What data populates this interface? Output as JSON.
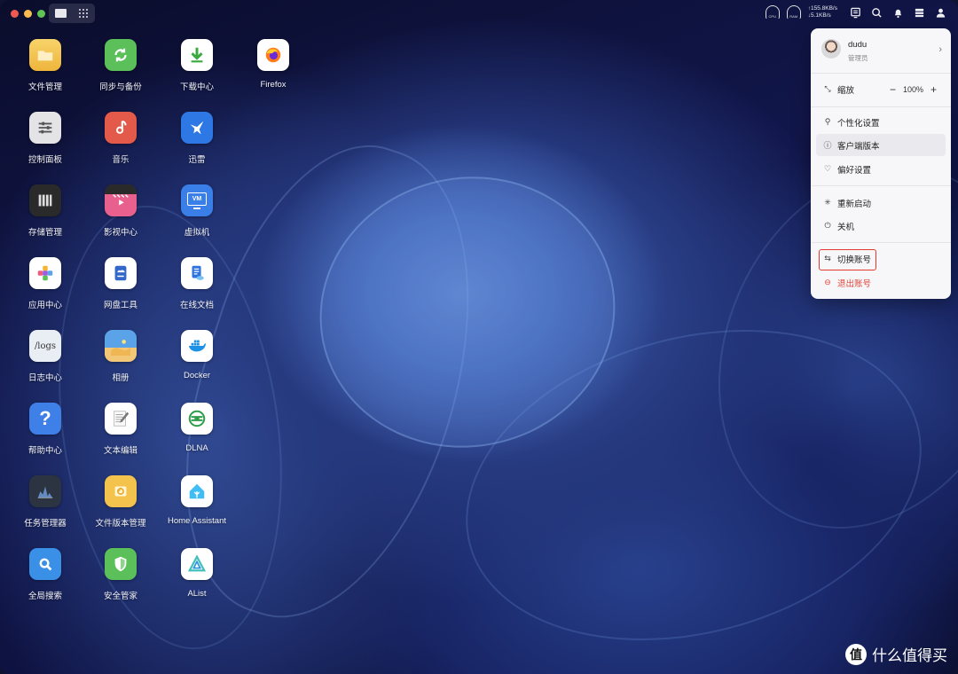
{
  "topbar": {
    "net_up": "↑155.8KB/s",
    "net_down": "↓5.1KB/s",
    "gauge1_label": "CPU",
    "gauge2_label": "RAM"
  },
  "apps": [
    {
      "label": "文件管理",
      "icon": "folder-icon",
      "color": "#f3c34e"
    },
    {
      "label": "同步与备份",
      "icon": "sync-icon",
      "color": "#5bbf5a"
    },
    {
      "label": "下载中心",
      "icon": "download-icon",
      "color": "#ffffff"
    },
    {
      "label": "Firefox",
      "icon": "firefox-icon",
      "color": "#ffffff"
    },
    {
      "label": "控制面板",
      "icon": "control-panel-icon",
      "color": "#e6e6e6"
    },
    {
      "label": "音乐",
      "icon": "music-icon",
      "color": "#e45a4a"
    },
    {
      "label": "迅雷",
      "icon": "thunder-icon",
      "color": "#2e78e6"
    },
    {
      "label": "存储管理",
      "icon": "storage-icon",
      "color": "#2a2a2a"
    },
    {
      "label": "影视中心",
      "icon": "video-icon",
      "color": "#e85a8a"
    },
    {
      "label": "虚拟机",
      "icon": "vm-icon",
      "color": "#3a7ee8"
    },
    {
      "label": "应用中心",
      "icon": "app-center-icon",
      "color": "#ffffff"
    },
    {
      "label": "网盘工具",
      "icon": "cloud-drive-icon",
      "color": "#ffffff"
    },
    {
      "label": "在线文档",
      "icon": "document-icon",
      "color": "#ffffff"
    },
    {
      "label": "日志中心",
      "icon": "logs-icon",
      "color": "#e9eef5"
    },
    {
      "label": "相册",
      "icon": "photo-icon",
      "color": "#5aa3e8"
    },
    {
      "label": "Docker",
      "icon": "docker-icon",
      "color": "#ffffff"
    },
    {
      "label": "帮助中心",
      "icon": "help-icon",
      "color": "#3f7fe8"
    },
    {
      "label": "文本编辑",
      "icon": "text-editor-icon",
      "color": "#ffffff"
    },
    {
      "label": "DLNA",
      "icon": "dlna-icon",
      "color": "#ffffff"
    },
    {
      "label": "任务管理器",
      "icon": "task-manager-icon",
      "color": "#2b3440"
    },
    {
      "label": "文件版本管理",
      "icon": "file-version-icon",
      "color": "#f3c34e"
    },
    {
      "label": "Home Assistant",
      "icon": "home-assistant-icon",
      "color": "#ffffff"
    },
    {
      "label": "全局搜索",
      "icon": "global-search-icon",
      "color": "#3a8fe6"
    },
    {
      "label": "安全管家",
      "icon": "security-icon",
      "color": "#5bbf5a"
    },
    {
      "label": "AList",
      "icon": "alist-icon",
      "color": "#ffffff"
    }
  ],
  "logs_icon_text": "/logs",
  "vm_icon_text": "VM",
  "help_icon_text": "?",
  "menu": {
    "username": "dudu",
    "role": "管理员",
    "zoom_label": "缩放",
    "zoom_value": "100%",
    "zoom_minus": "−",
    "zoom_plus": "+",
    "personalize": "个性化设置",
    "client_version": "客户端版本",
    "preferences": "偏好设置",
    "restart": "重新启动",
    "shutdown": "关机",
    "switch_account": "切换账号",
    "logout": "退出账号"
  },
  "watermark": {
    "logo": "值",
    "text": "什么值得买"
  },
  "colors": {
    "accent_red": "#e0463c",
    "menu_bg": "#f7f7f9"
  }
}
